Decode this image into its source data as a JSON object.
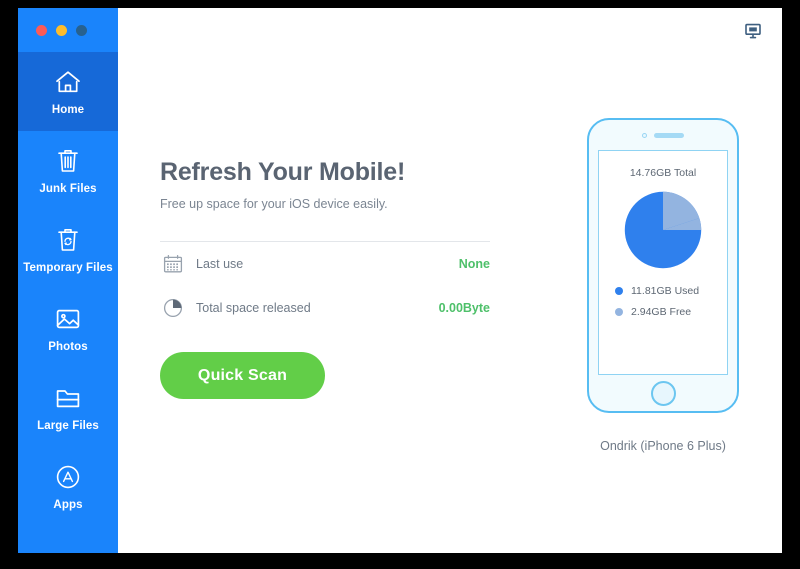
{
  "window": {
    "traffic_lights": [
      {
        "name": "close",
        "color": "#fc5b57"
      },
      {
        "name": "minimize",
        "color": "#fdbc2d"
      },
      {
        "name": "zoom",
        "color": "#27618f"
      }
    ]
  },
  "sidebar": {
    "background": "#1a84fb",
    "active_background": "#1669d8",
    "items": [
      {
        "label": "Home",
        "icon": "home-icon",
        "active": true
      },
      {
        "label": "Junk Files",
        "icon": "trash-icon",
        "active": false
      },
      {
        "label": "Temporary Files",
        "icon": "recycle-trash-icon",
        "active": false
      },
      {
        "label": "Photos",
        "icon": "photo-icon",
        "active": false
      },
      {
        "label": "Large Files",
        "icon": "folder-icon",
        "active": false
      },
      {
        "label": "Apps",
        "icon": "app-store-icon",
        "active": false
      }
    ]
  },
  "header": {
    "display_icon": "monitor-icon"
  },
  "main": {
    "headline": "Refresh Your Mobile!",
    "subhead": "Free up space for your iOS device easily.",
    "stats": [
      {
        "icon": "calendar-icon",
        "label": "Last use",
        "value": "None",
        "value_color": "#4ec06a"
      },
      {
        "icon": "pie-icon",
        "label": "Total space released",
        "value": "0.00Byte",
        "value_color": "#4ec06a"
      }
    ],
    "quick_scan_label": "Quick Scan",
    "quick_scan_color": "#62ce48"
  },
  "device": {
    "name": "Ondrik (iPhone 6 Plus)",
    "total_label": "14.76GB Total",
    "legend": [
      {
        "label": "11.81GB Used",
        "color": "#2f80ed"
      },
      {
        "label": "2.94GB Free",
        "color": "#93b4e0"
      }
    ]
  },
  "chart_data": {
    "type": "pie",
    "title": "14.76GB Total",
    "categories": [
      "11.81GB Used",
      "2.94GB Free"
    ],
    "values": [
      11.81,
      2.94
    ],
    "units": "GB",
    "total": 14.76,
    "percentages": [
      80.0,
      20.0
    ],
    "colors": [
      "#2f80ed",
      "#93b4e0"
    ],
    "legend_position": "bottom-left",
    "start_angle_deg": 0,
    "direction": "clockwise",
    "grid": false
  }
}
